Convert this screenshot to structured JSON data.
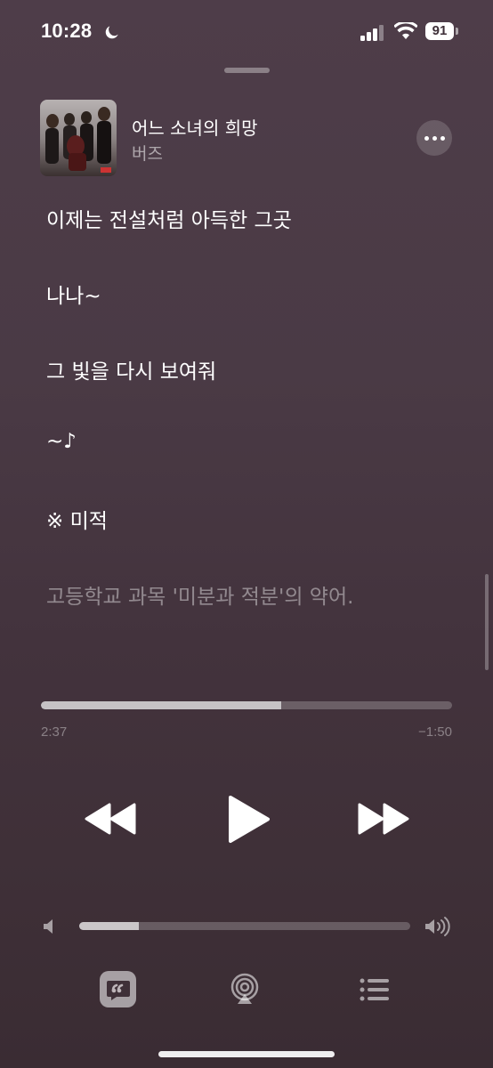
{
  "status_bar": {
    "time": "10:28",
    "moon_icon": "moon-icon",
    "signal_icon": "cellular-signal-icon",
    "wifi_icon": "wifi-icon",
    "battery_level": "91"
  },
  "now_playing": {
    "title": "어느 소녀의 희망",
    "artist": "버즈",
    "more_icon": "ellipsis-icon"
  },
  "lyrics": [
    {
      "text": "이제는 전설처럼 아득한 그곳",
      "style": "active"
    },
    {
      "text": "나나~",
      "style": "active"
    },
    {
      "text": "그 빛을 다시 보여줘",
      "style": "active"
    },
    {
      "text": "~♪",
      "style": "active"
    },
    {
      "text": "※ 미적",
      "style": "active"
    },
    {
      "text": "고등학교 과목 '미분과 적분'의 약어.",
      "style": "dim"
    }
  ],
  "playback": {
    "elapsed": "2:37",
    "remaining": "−1:50",
    "progress_fraction": 0.585
  },
  "controls": {
    "rewind_icon": "rewind-icon",
    "play_icon": "play-icon",
    "fast_forward_icon": "fast-forward-icon"
  },
  "volume": {
    "level_fraction": 0.18,
    "low_icon": "speaker-low-icon",
    "high_icon": "speaker-high-icon"
  },
  "bottom_bar": {
    "lyrics_icon": "lyrics-quote-icon",
    "airplay_icon": "airplay-audio-icon",
    "queue_icon": "queue-list-icon"
  },
  "colors": {
    "background_top": "#4e3d49",
    "background_bottom": "#3a2c33"
  }
}
